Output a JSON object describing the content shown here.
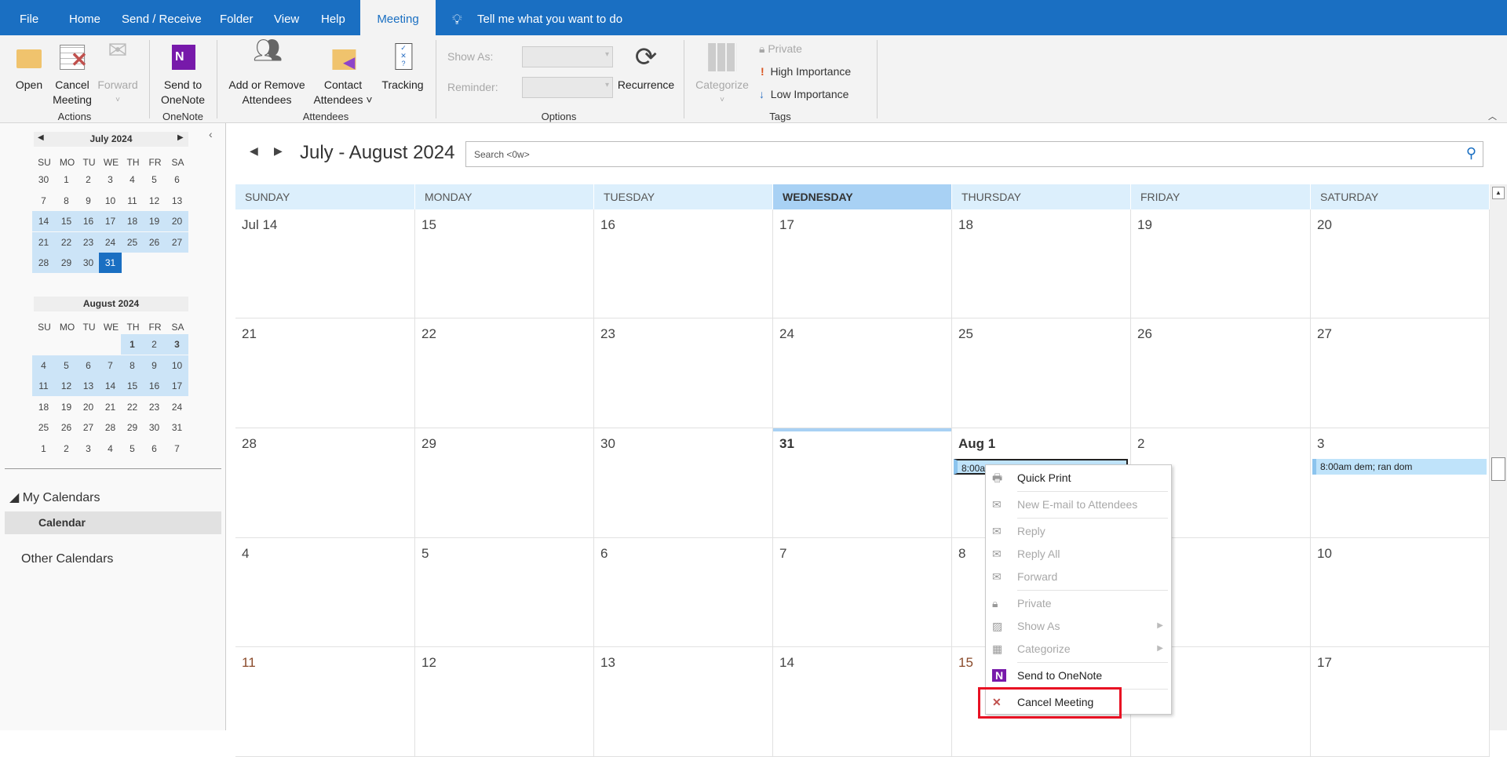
{
  "tabs": [
    "File",
    "Home",
    "Send / Receive",
    "Folder",
    "View",
    "Help",
    "Meeting"
  ],
  "tell_me": "Tell me what you want to do",
  "ribbon": {
    "actions": {
      "label": "Actions",
      "open": "Open",
      "cancel1": "Cancel",
      "cancel2": "Meeting",
      "forward": "Forward"
    },
    "onenote": {
      "label": "OneNote",
      "l1": "Send to",
      "l2": "OneNote"
    },
    "attendees": {
      "label": "Attendees",
      "add1": "Add or Remove",
      "add2": "Attendees",
      "contact1": "Contact",
      "contact2": "Attendees ˅",
      "tracking": "Tracking"
    },
    "options": {
      "label": "Options",
      "show_as": "Show As:",
      "reminder": "Reminder:",
      "recurrence": "Recurrence"
    },
    "tags": {
      "label": "Tags",
      "categorize": "Categorize",
      "private": "Private",
      "high": "High Importance",
      "low": "Low Importance"
    }
  },
  "mini": {
    "dow": [
      "SU",
      "MO",
      "TU",
      "WE",
      "TH",
      "FR",
      "SA"
    ],
    "july": {
      "title": "July 2024",
      "weeks": [
        [
          "30",
          "1",
          "2",
          "3",
          "4",
          "5",
          "6"
        ],
        [
          "7",
          "8",
          "9",
          "10",
          "11",
          "12",
          "13"
        ],
        [
          "14",
          "15",
          "16",
          "17",
          "18",
          "19",
          "20"
        ],
        [
          "21",
          "22",
          "23",
          "24",
          "25",
          "26",
          "27"
        ],
        [
          "28",
          "29",
          "30",
          "31",
          "",
          "",
          ""
        ]
      ]
    },
    "august": {
      "title": "August 2024",
      "weeks": [
        [
          "",
          "",
          "",
          "",
          "1",
          "2",
          "3"
        ],
        [
          "4",
          "5",
          "6",
          "7",
          "8",
          "9",
          "10"
        ],
        [
          "11",
          "12",
          "13",
          "14",
          "15",
          "16",
          "17"
        ],
        [
          "18",
          "19",
          "20",
          "21",
          "22",
          "23",
          "24"
        ],
        [
          "25",
          "26",
          "27",
          "28",
          "29",
          "30",
          "31"
        ],
        [
          "1",
          "2",
          "3",
          "4",
          "5",
          "6",
          "7"
        ]
      ]
    }
  },
  "nav": {
    "my_calendars": "My Calendars",
    "calendar": "Calendar",
    "other": "Other Calendars"
  },
  "header": {
    "title": "July - August 2024",
    "search_placeholder": "Search <0w>"
  },
  "days": [
    "SUNDAY",
    "MONDAY",
    "TUESDAY",
    "WEDNESDAY",
    "THURSDAY",
    "FRIDAY",
    "SATURDAY"
  ],
  "weeks": [
    [
      "Jul 14",
      "15",
      "16",
      "17",
      "18",
      "19",
      "20"
    ],
    [
      "21",
      "22",
      "23",
      "24",
      "25",
      "26",
      "27"
    ],
    [
      "28",
      "29",
      "30",
      "31",
      "Aug 1",
      "2",
      "3"
    ],
    [
      "4",
      "5",
      "6",
      "7",
      "8",
      "9",
      "10"
    ],
    [
      "11",
      "12",
      "13",
      "14",
      "15",
      "16",
      "17"
    ]
  ],
  "events": [
    {
      "week": 2,
      "day": 4,
      "text": "8:00am dem; ran dom",
      "selected": true
    },
    {
      "week": 2,
      "day": 6,
      "text": "8:00am dem; ran dom"
    }
  ],
  "menu": [
    {
      "label": "Quick Print",
      "icon": "printer-icon",
      "enabled": true
    },
    {
      "sep": true
    },
    {
      "label": "New E-mail to Attendees",
      "icon": "email-icon",
      "enabled": false
    },
    {
      "sep": true
    },
    {
      "label": "Reply",
      "icon": "reply-icon",
      "enabled": false
    },
    {
      "label": "Reply All",
      "icon": "reply-all-icon",
      "enabled": false
    },
    {
      "label": "Forward",
      "icon": "forward-icon",
      "enabled": false
    },
    {
      "sep": true
    },
    {
      "label": "Private",
      "icon": "lock-icon",
      "enabled": false
    },
    {
      "label": "Show As",
      "icon": "show-as-icon",
      "enabled": false,
      "submenu": true
    },
    {
      "label": "Categorize",
      "icon": "categorize-icon",
      "enabled": false,
      "submenu": true
    },
    {
      "sep": true
    },
    {
      "label": "Send to OneNote",
      "icon": "onenote-icon",
      "enabled": true
    },
    {
      "sep": true
    },
    {
      "label": "Cancel Meeting",
      "icon": "cancel-meeting-icon",
      "enabled": true,
      "highlighted": true
    }
  ],
  "colors": {
    "accent": "#1a6fc2",
    "highlight_box": "#e81123",
    "today": "#a8d1f4"
  }
}
